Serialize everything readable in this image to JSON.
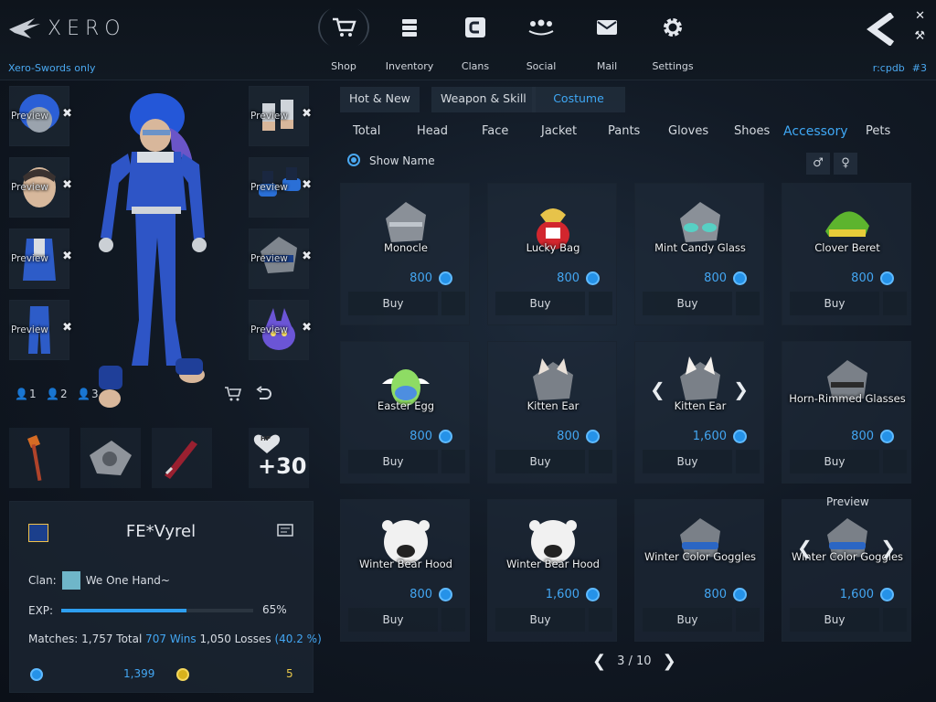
{
  "app": {
    "logo": "XERO",
    "mode_label": "Xero-Swords only",
    "server": "r:cpdb",
    "channel": "#3"
  },
  "nav": [
    {
      "label": "Shop",
      "icon": "cart-icon"
    },
    {
      "label": "Inventory",
      "icon": "inventory-icon"
    },
    {
      "label": "Clans",
      "icon": "clans-icon"
    },
    {
      "label": "Social",
      "icon": "social-icon"
    },
    {
      "label": "Mail",
      "icon": "mail-icon"
    },
    {
      "label": "Settings",
      "icon": "gear-icon"
    }
  ],
  "preview": {
    "label": "Preview",
    "presets": [
      "1",
      "2",
      "3"
    ]
  },
  "hp_bonus": "+30",
  "hp_tag": "HP",
  "profile": {
    "name": "FE*Vyrel",
    "clan_label": "Clan:",
    "clan_name": "We One Hand~",
    "exp_label": "EXP:",
    "exp_percent": "65%",
    "exp_fraction": 0.65,
    "matches_label": "Matches:",
    "matches_total": "1,757 Total",
    "wins": "707 Wins",
    "losses": "1,050 Losses",
    "win_rate": "(40.2 %)",
    "blue_currency": "1,399",
    "gold_currency": "5"
  },
  "tabs": [
    "Hot & New",
    "Weapon & Skill",
    "Costume"
  ],
  "active_tab": "Costume",
  "categories": [
    "Total",
    "Head",
    "Face",
    "Jacket",
    "Pants",
    "Gloves",
    "Shoes",
    "Accessory",
    "Pets"
  ],
  "active_category": "Accessory",
  "show_name_label": "Show Name",
  "gender_buttons": [
    "♂",
    "♀"
  ],
  "items": [
    {
      "name": "Monocle",
      "price": "800",
      "buy": "Buy"
    },
    {
      "name": "Lucky Bag",
      "price": "800",
      "buy": "Buy"
    },
    {
      "name": "Mint Candy Glass",
      "price": "800",
      "buy": "Buy"
    },
    {
      "name": "Clover Beret",
      "price": "800",
      "buy": "Buy"
    },
    {
      "name": "Easter Egg",
      "price": "800",
      "buy": "Buy"
    },
    {
      "name": "Kitten Ear",
      "price": "800",
      "buy": "Buy"
    },
    {
      "name": "Kitten Ear",
      "price": "1,600",
      "buy": "Buy"
    },
    {
      "name": "Horn-Rimmed Glasses",
      "price": "800",
      "buy": "Buy"
    },
    {
      "name": "Winter Bear Hood",
      "price": "800",
      "buy": "Buy"
    },
    {
      "name": "Winter Bear Hood",
      "price": "1,600",
      "buy": "Buy"
    },
    {
      "name": "Winter Color Goggles",
      "price": "800",
      "buy": "Buy"
    },
    {
      "name": "Winter Color Goggles",
      "price": "1,600",
      "buy": "Buy"
    }
  ],
  "card_preview_label": "Preview",
  "pagination": "3 / 10",
  "colors": {
    "accent": "#3fa8f5",
    "background": "#121a25"
  }
}
